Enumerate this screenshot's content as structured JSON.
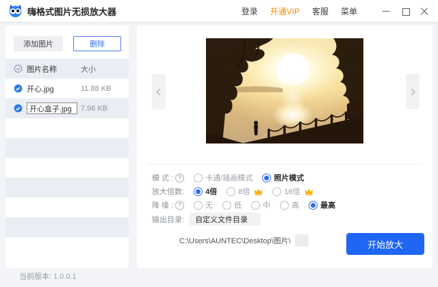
{
  "titlebar": {
    "app_title": "嗨格式图片无损放大器",
    "login_label": "登录",
    "vip_label": "开通VIP",
    "support_label": "客服",
    "menu_label": "菜单"
  },
  "sidebar": {
    "add_button_label": "添加图片",
    "delete_button_label": "删除",
    "header": {
      "name_col": "图片名称",
      "size_col": "大小"
    },
    "files": [
      {
        "name": "开心.jpg",
        "size": "11.88 KB",
        "checked": true,
        "renaming": false
      },
      {
        "name": "开心盒子.jpg",
        "size": "7.96 KB",
        "checked": true,
        "renaming": true
      }
    ]
  },
  "settings": {
    "help_glyph": "?",
    "mode": {
      "label": "模 式 :",
      "options": [
        {
          "label": "卡通/插画模式",
          "selected": false
        },
        {
          "label": "照片模式",
          "selected": true
        }
      ]
    },
    "scale": {
      "label": "放大倍数:",
      "options": [
        {
          "label": "4倍",
          "selected": true,
          "vip": false
        },
        {
          "label": "8倍",
          "selected": false,
          "vip": true
        },
        {
          "label": "16倍",
          "selected": false,
          "vip": true
        }
      ]
    },
    "denoise": {
      "label": "降 噪 :",
      "options": [
        {
          "label": "无",
          "selected": false
        },
        {
          "label": "低",
          "selected": false
        },
        {
          "label": "中",
          "selected": false
        },
        {
          "label": "高",
          "selected": false
        },
        {
          "label": "最高",
          "selected": true
        }
      ]
    },
    "output": {
      "label": "输出目录:",
      "value": "自定义文件目录",
      "path": "C:\\Users\\AUNTEC\\Desktop\\图片\\"
    },
    "start_button_label": "开始放大"
  },
  "footer": {
    "version_text": "当前版本: 1.0.0.1"
  },
  "colors": {
    "accent_blue": "#1f66f3",
    "vip_orange": "#fb8b05",
    "row_stripe": "#eaedf3"
  }
}
